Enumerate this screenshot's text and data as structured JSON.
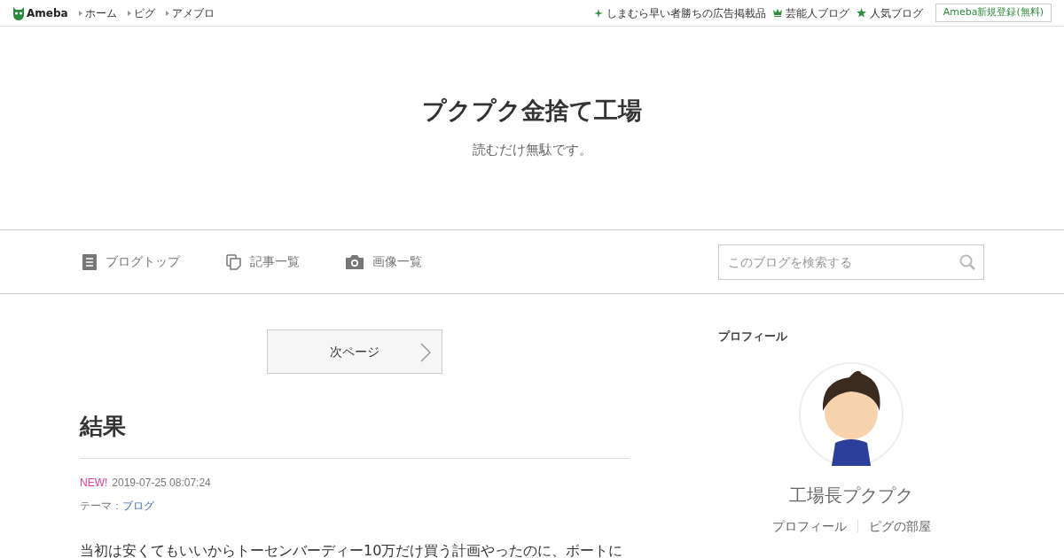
{
  "topbar": {
    "logo": "Ameba",
    "links": [
      {
        "label": "ホーム"
      },
      {
        "label": "ピグ"
      },
      {
        "label": "アメブロ"
      }
    ],
    "right_links": [
      {
        "label": "しまむら早い者勝ちの広告掲載品",
        "kind": "sparkle"
      },
      {
        "label": "芸能人ブログ",
        "kind": "crown"
      },
      {
        "label": "人気ブログ",
        "kind": "star"
      }
    ],
    "register": "Ameba新規登録(無料)"
  },
  "header": {
    "title": "プクプク金捨て工場",
    "subtitle": "読むだけ無駄です。"
  },
  "nav": {
    "items": [
      {
        "label": "ブログトップ",
        "kind": "doc"
      },
      {
        "label": "記事一覧",
        "kind": "copy"
      },
      {
        "label": "画像一覧",
        "kind": "camera"
      }
    ],
    "search": {
      "placeholder": "このブログを検索する"
    }
  },
  "pager": {
    "next": "次ページ"
  },
  "entry": {
    "title": "結果",
    "new_badge": "NEW!",
    "date": "2019-07-25 08:07:24",
    "theme_label": "テーマ：",
    "theme": "ブログ",
    "body": "当初は安くてもいいからトーセンバーディー10万だけ買う計画やったのに、ボートに"
  },
  "profile": {
    "heading": "プロフィール",
    "name": "工場長プクプク",
    "links": [
      {
        "label": "プロフィール"
      },
      {
        "label": "ピグの部屋"
      }
    ]
  }
}
